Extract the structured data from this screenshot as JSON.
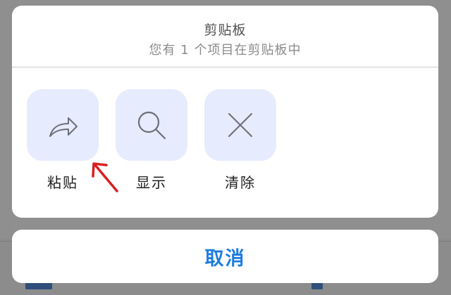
{
  "sheet": {
    "title": "剪贴板",
    "subtitle": "您有 1 个项目在剪贴板中"
  },
  "actions": [
    {
      "label": "粘贴",
      "icon": "share-arrow-icon"
    },
    {
      "label": "显示",
      "icon": "search-icon"
    },
    {
      "label": "清除",
      "icon": "close-icon"
    }
  ],
  "cancel": {
    "label": "取消"
  },
  "colors": {
    "tile_background": "#e6ebfd",
    "icon_stroke": "#6e6e78",
    "cancel_text": "#1a7bde",
    "annotation": "#d82020"
  }
}
